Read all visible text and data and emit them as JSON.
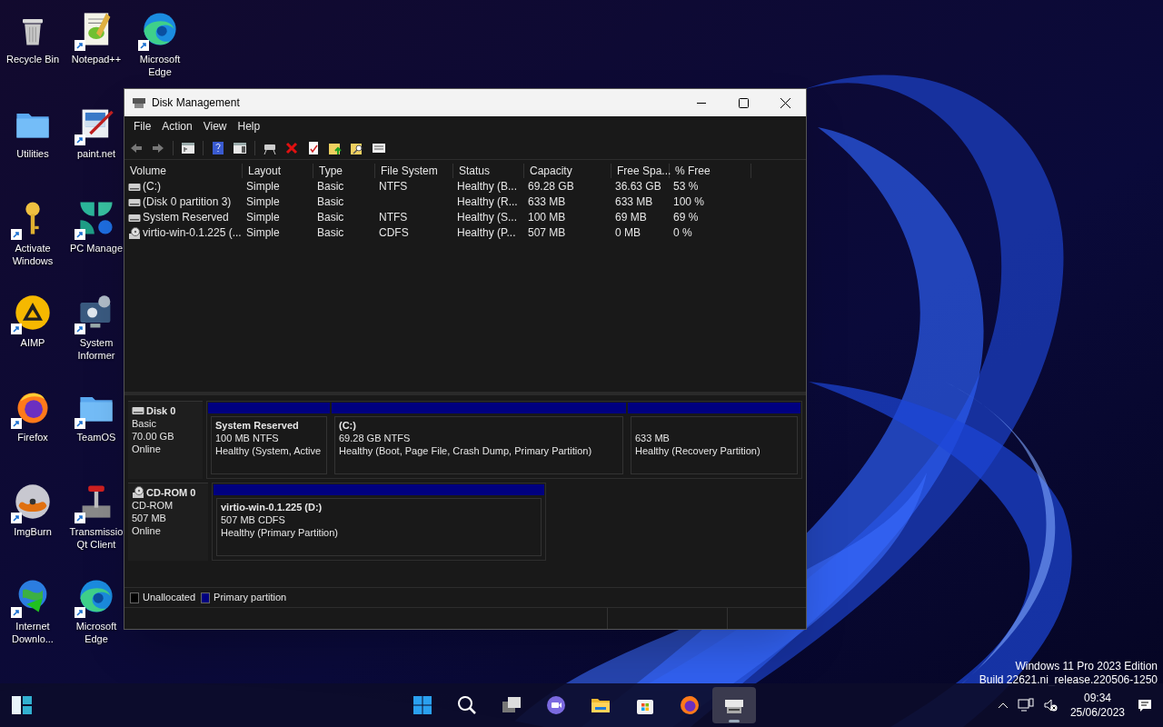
{
  "desktop_columns": [
    {
      "icons": [
        {
          "label": "Recycle Bin",
          "kind": "bin",
          "shortcut": false
        },
        {
          "label": "Utilities",
          "kind": "folder",
          "shortcut": false
        },
        {
          "label": "Activate Windows",
          "kind": "key",
          "shortcut": true
        },
        {
          "label": "AIMP",
          "kind": "aimp",
          "shortcut": true
        },
        {
          "label": "Firefox",
          "kind": "firefox",
          "shortcut": true
        },
        {
          "label": "ImgBurn",
          "kind": "disc",
          "shortcut": true
        },
        {
          "label": "Internet Downlo...",
          "kind": "globe",
          "shortcut": true
        }
      ]
    },
    {
      "icons": [
        {
          "label": "Notepad++",
          "kind": "notepad",
          "shortcut": true
        },
        {
          "label": "paint.net",
          "kind": "paint",
          "shortcut": true
        },
        {
          "label": "PC Manage",
          "kind": "pcmanager",
          "shortcut": true
        },
        {
          "label": "System Informer",
          "kind": "sysinfo",
          "shortcut": true
        },
        {
          "label": "TeamOS",
          "kind": "folder",
          "shortcut": true
        },
        {
          "label": "Transmissio Qt Client",
          "kind": "joystick",
          "shortcut": true
        },
        {
          "label": "Microsoft Edge",
          "kind": "edge",
          "shortcut": true
        }
      ]
    },
    {
      "icons": [
        {
          "label": "Microsoft Edge",
          "kind": "edge",
          "shortcut": true
        }
      ]
    }
  ],
  "window": {
    "title": "Disk Management",
    "menu": [
      "File",
      "Action",
      "View",
      "Help"
    ],
    "toolbar": [
      {
        "kind": "back"
      },
      {
        "kind": "forward"
      },
      {
        "kind": "sep"
      },
      {
        "kind": "tree"
      },
      {
        "kind": "sep"
      },
      {
        "kind": "help"
      },
      {
        "kind": "pane"
      },
      {
        "kind": "sep"
      },
      {
        "kind": "connect"
      },
      {
        "kind": "delete"
      },
      {
        "kind": "properties"
      },
      {
        "kind": "folder-up"
      },
      {
        "kind": "folder-search"
      },
      {
        "kind": "list"
      }
    ],
    "table": {
      "columns": [
        "Volume",
        "Layout",
        "Type",
        "File System",
        "Status",
        "Capacity",
        "Free Spa...",
        "% Free"
      ],
      "rows": [
        {
          "kind": "disk",
          "volume": "(C:)",
          "layout": "Simple",
          "type": "Basic",
          "file_system": "NTFS",
          "status": "Healthy (B...",
          "capacity": "69.28 GB",
          "free_space": "36.63 GB",
          "percent_free": "53 %"
        },
        {
          "kind": "disk",
          "volume": "(Disk 0 partition 3)",
          "layout": "Simple",
          "type": "Basic",
          "status": "Healthy (R...",
          "capacity": "633 MB",
          "free_space": "633 MB",
          "percent_free": "100 %"
        },
        {
          "kind": "disk",
          "volume": "System Reserved",
          "layout": "Simple",
          "type": "Basic",
          "file_system": "NTFS",
          "status": "Healthy (S...",
          "capacity": "100 MB",
          "free_space": "69 MB",
          "percent_free": "69 %"
        },
        {
          "kind": "cd",
          "volume": "virtio-win-0.1.225 (...",
          "layout": "Simple",
          "type": "Basic",
          "file_system": "CDFS",
          "status": "Healthy (P...",
          "capacity": "507 MB",
          "free_space": "0 MB",
          "percent_free": "0 %"
        }
      ]
    },
    "disks": [
      {
        "kind": "disk",
        "name": "Disk 0",
        "type": "Basic",
        "size": "70.00 GB",
        "status": "Online",
        "partitions": [
          {
            "title": "System Reserved",
            "size": "100 MB NTFS",
            "status": "Healthy (System, Active"
          },
          {
            "title": "(C:)",
            "size": "69.28 GB NTFS",
            "status": "Healthy (Boot, Page File, Crash Dump, Primary Partition)"
          },
          {
            "size": "633 MB",
            "status": "Healthy (Recovery Partition)"
          }
        ]
      },
      {
        "kind": "cd",
        "name": "CD-ROM 0",
        "type": "CD-ROM",
        "size": "507 MB",
        "status": "Online",
        "partitions": [
          {
            "title": "virtio-win-0.1.225  (D:)",
            "size": "507 MB CDFS",
            "status": "Healthy (Primary Partition)"
          }
        ]
      }
    ],
    "legend": [
      {
        "label": "Unallocated",
        "color": "#000000"
      },
      {
        "label": "Primary partition",
        "color": "#000080"
      }
    ]
  },
  "watermark_text": [
    "Windows 11 Pro 2023 Edition",
    "Build 22621.ni_release.220506-1250"
  ],
  "taskbar": {
    "items": [
      {
        "kind": "start",
        "selected": false
      },
      {
        "kind": "search",
        "selected": false
      },
      {
        "kind": "taskview",
        "selected": false
      },
      {
        "kind": "chat",
        "selected": false
      },
      {
        "kind": "explorer",
        "selected": false
      },
      {
        "kind": "store",
        "selected": false
      },
      {
        "kind": "firefox",
        "selected": false
      },
      {
        "kind": "diskmgmt",
        "selected": true
      }
    ],
    "time": "09:34",
    "date": "25/06/2023"
  }
}
